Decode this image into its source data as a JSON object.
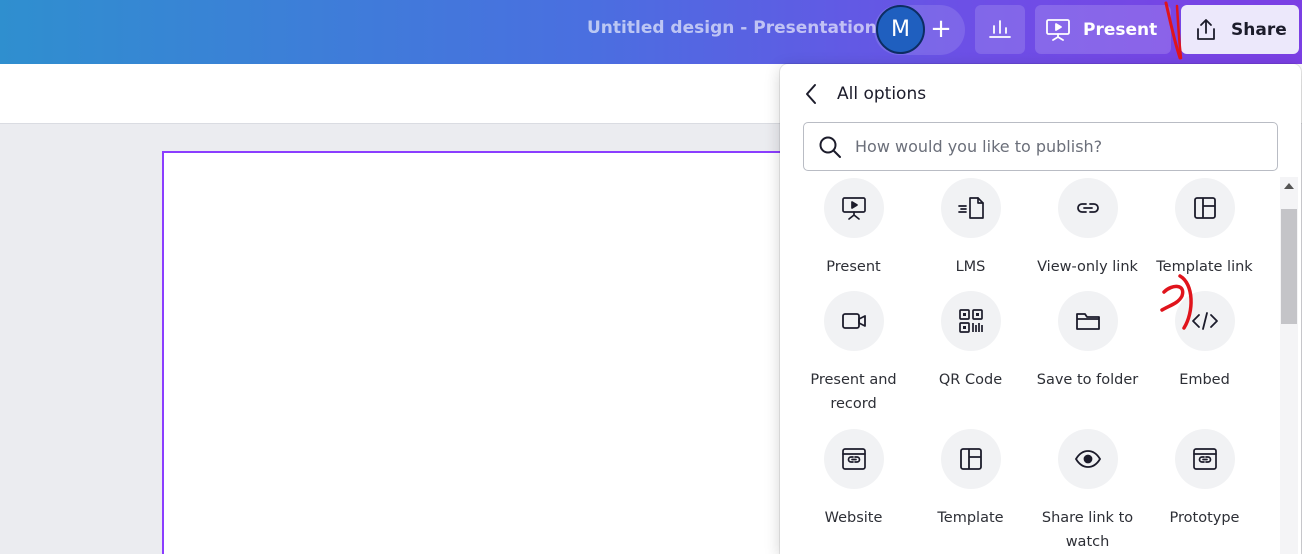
{
  "topbar": {
    "doc_title": "Untitled design - Presentation",
    "avatar_initial": "M",
    "add_label": "+",
    "present_label": "Present",
    "share_label": "Share",
    "gradient_start": "#2f8fcf",
    "gradient_end": "#7b3fe4"
  },
  "panel": {
    "title": "All options",
    "search_placeholder": "How would you like to publish?",
    "options": [
      {
        "label": "Present",
        "icon": "present-screen-icon"
      },
      {
        "label": "LMS",
        "icon": "lms-document-icon"
      },
      {
        "label": "View-only link",
        "icon": "link-icon"
      },
      {
        "label": "Template link",
        "icon": "template-layout-icon"
      },
      {
        "label": "Present and record",
        "icon": "video-camera-icon"
      },
      {
        "label": "QR Code",
        "icon": "qr-code-icon"
      },
      {
        "label": "Save to folder",
        "icon": "folder-icon"
      },
      {
        "label": "Embed",
        "icon": "embed-code-icon"
      },
      {
        "label": "Website",
        "icon": "website-icon"
      },
      {
        "label": "Template",
        "icon": "template-layout-icon"
      },
      {
        "label": "Share link to watch",
        "icon": "eye-icon"
      },
      {
        "label": "Prototype",
        "icon": "prototype-icon"
      }
    ]
  },
  "colors": {
    "accent_purple": "#8b3dff",
    "annotation_red": "#e0141c"
  }
}
